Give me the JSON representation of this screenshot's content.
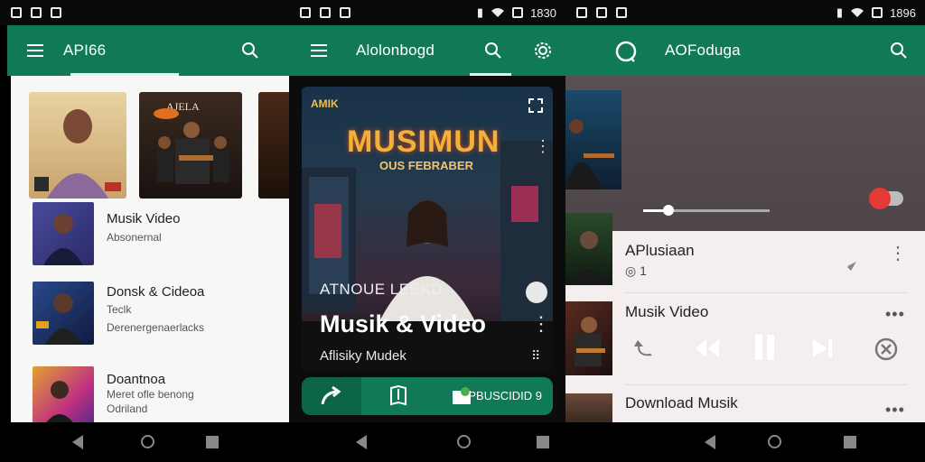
{
  "colors": {
    "accent": "#0f7a55",
    "accent_dark": "#0b6546",
    "record": "#e53935"
  },
  "screens": {
    "library": {
      "appbar_title": "API66",
      "rows": [
        {
          "title": "Musik Video",
          "sub1": "Absonernal",
          "sub2": ""
        },
        {
          "title": "Donsk & Cideoa",
          "sub1": "Teclk",
          "sub2": "Derenergenaerlacks"
        },
        {
          "title": "Doantnoa",
          "sub1": "Meret ofle benong",
          "sub2": "Odriland"
        }
      ],
      "icons": [
        "menu-icon",
        "search-icon"
      ]
    },
    "now_playing": {
      "appbar_title": "Alolonbogd",
      "poster_brand": "AMIK",
      "poster_title": "MUSIMUN",
      "poster_subtitle": "OUS FEBRABER",
      "artist": "ATNOUE LEEKD",
      "title": "Musik & Video",
      "subtitle": "Aflisiky Mudek",
      "action_label": "PBUSCIDID 9",
      "icons": [
        "menu-icon",
        "search-icon",
        "settings-icon",
        "expand-icon",
        "more-vertical-icon",
        "share-icon",
        "lyrics-icon",
        "folder-icon"
      ]
    },
    "player": {
      "appbar_title": "AOFoduga",
      "slider_progress": 0.2,
      "list": [
        {
          "title": "APlusiaan",
          "sub": "◎ 1"
        },
        {
          "title": "Musik Video",
          "sub": ""
        },
        {
          "title": "Download Musik",
          "sub": ""
        }
      ],
      "icons": [
        "search-icon",
        "more-vertical-icon",
        "pin-icon",
        "repeat-icon",
        "rewind-icon",
        "pause-icon",
        "skip-next-icon",
        "close-circle-icon"
      ]
    }
  },
  "status": {
    "clock": "1896",
    "clock_mid": "1830"
  }
}
